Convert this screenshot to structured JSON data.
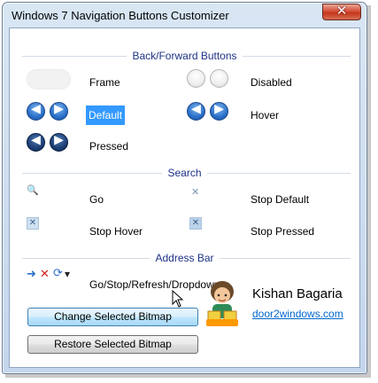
{
  "window": {
    "title": "Windows 7 Navigation Buttons Customizer",
    "close_glyph": "✕"
  },
  "sections": {
    "back_forward": "Back/Forward Buttons",
    "search": "Search",
    "address_bar": "Address Bar"
  },
  "back_forward_items": {
    "frame": "Frame",
    "disabled": "Disabled",
    "default": "Default",
    "hover": "Hover",
    "pressed": "Pressed",
    "selected": "Default"
  },
  "search_items": {
    "go": "Go",
    "stop_default": "Stop Default",
    "stop_hover": "Stop Hover",
    "stop_pressed": "Stop Pressed"
  },
  "address_items": {
    "go_stop_refresh_dropdown": "Go/Stop/Refresh/Dropdown"
  },
  "buttons": {
    "change": "Change Selected Bitmap",
    "restore": "Restore Selected Bitmap"
  },
  "author": {
    "name": "Kishan Bagaria",
    "link": "door2windows.com"
  },
  "icons": {
    "back_arrow": "◀",
    "forward_arrow": "▶",
    "search": "🔍",
    "stop": "✕",
    "go_arrow": "➜",
    "refresh": "⟳",
    "dropdown": "▾"
  },
  "colors": {
    "section_title": "#1e3287",
    "selection": "#3399ff",
    "link": "#0066cc",
    "close_button": "#c3371b"
  }
}
